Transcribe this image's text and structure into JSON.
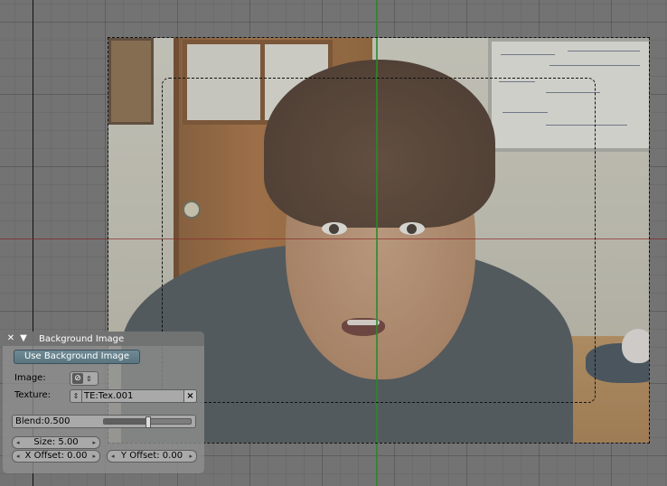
{
  "panel": {
    "title": "Background Image",
    "use_button": "Use Background Image",
    "image_label": "Image:",
    "texture_label": "Texture:",
    "texture_value": "TE:Tex.001",
    "texture_clear": "×",
    "blend_text": "Blend:0.500",
    "blend_value": 0.5,
    "size_text": "Size: 5.00",
    "x_offset_text": "X Offset: 0.00",
    "y_offset_text": "Y Offset: 0.00"
  },
  "icons": {
    "close": "close-icon",
    "collapse": "triangle-down-icon",
    "image": "image-browse-icon",
    "arrows": "up-down-arrows-icon"
  }
}
